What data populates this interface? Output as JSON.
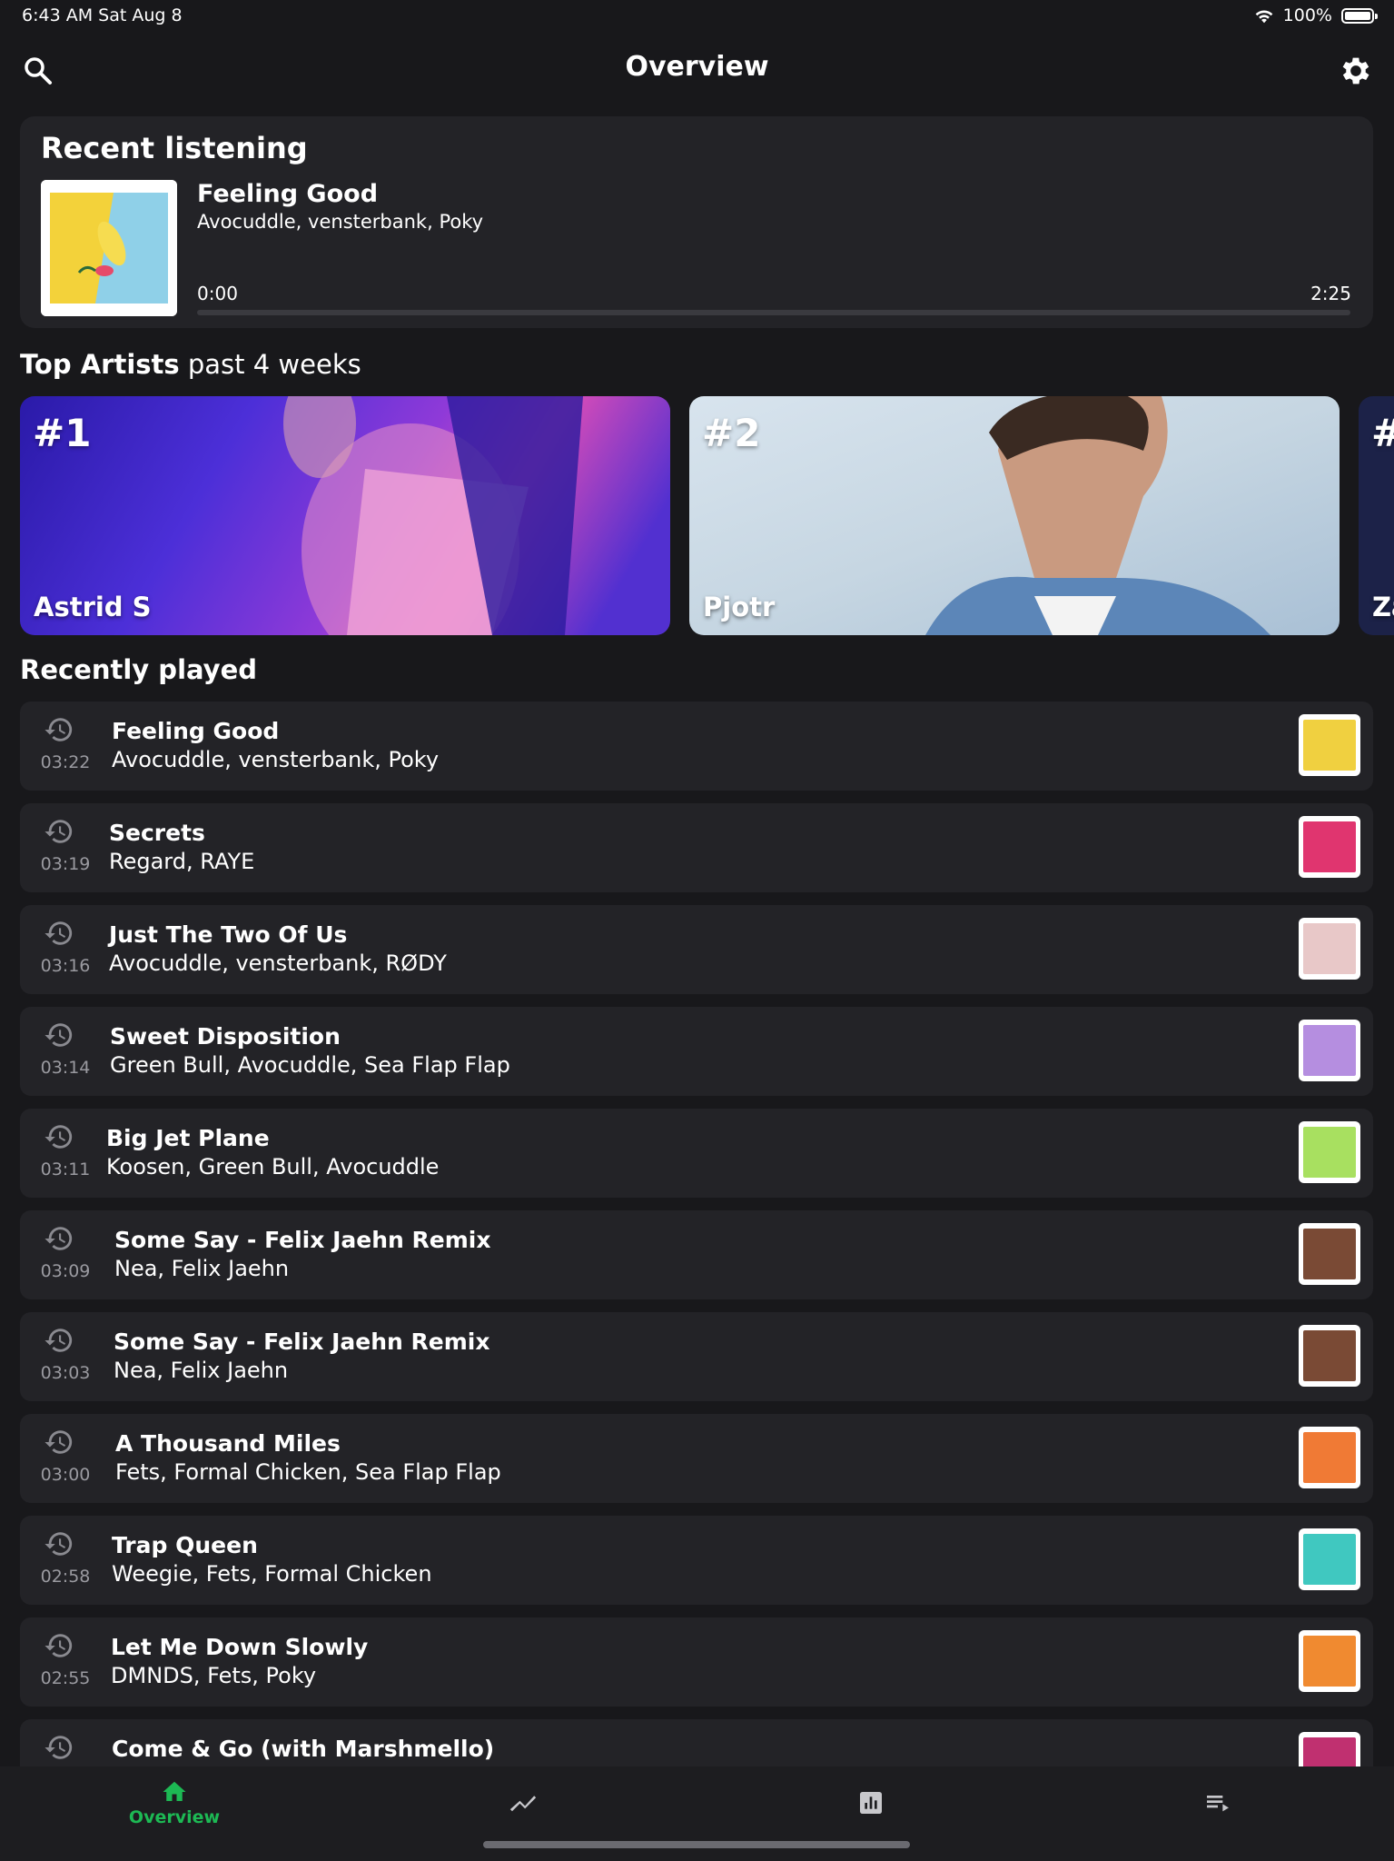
{
  "status_bar": {
    "time": "6:43 AM   Sat Aug 8",
    "battery": "100%",
    "battery_level": 1.0
  },
  "header": {
    "title": "Overview",
    "search_icon": "search-icon",
    "settings_icon": "gear-icon"
  },
  "recent_listening": {
    "title": "Recent listening",
    "song": "Feeling Good",
    "artists": "Avocuddle, vensterbank, Poky",
    "elapsed": "0:00",
    "duration": "2:25",
    "progress": 0.0
  },
  "top_artists": {
    "title_bold": "Top Artists",
    "title_rest": " past 4 weeks",
    "items": [
      {
        "rank": "#1",
        "name": "Astrid S"
      },
      {
        "rank": "#2",
        "name": "Pjotr"
      },
      {
        "rank": "#",
        "name": "Za"
      }
    ]
  },
  "recently_played": {
    "title": "Recently played",
    "items": [
      {
        "time": "03:22",
        "name": "Feeling Good",
        "artists": "Avocuddle, vensterbank, Poky",
        "thumb": "#f0d040"
      },
      {
        "time": "03:19",
        "name": "Secrets",
        "artists": "Regard, RAYE",
        "thumb": "#e0356f"
      },
      {
        "time": "03:16",
        "name": "Just The Two Of Us",
        "artists": "Avocuddle, vensterbank, RØDY",
        "thumb": "#e8c8c8"
      },
      {
        "time": "03:14",
        "name": "Sweet Disposition",
        "artists": "Green Bull, Avocuddle, Sea Flap Flap",
        "thumb": "#b58ee0"
      },
      {
        "time": "03:11",
        "name": "Big Jet Plane",
        "artists": "Koosen, Green Bull, Avocuddle",
        "thumb": "#a8e060"
      },
      {
        "time": "03:09",
        "name": "Some Say - Felix Jaehn Remix",
        "artists": "Nea, Felix Jaehn",
        "thumb": "#7a4a35"
      },
      {
        "time": "03:03",
        "name": "Some Say - Felix Jaehn Remix",
        "artists": "Nea, Felix Jaehn",
        "thumb": "#7a4a35"
      },
      {
        "time": "03:00",
        "name": "A Thousand Miles",
        "artists": "Fets, Formal Chicken, Sea Flap Flap",
        "thumb": "#f07a35"
      },
      {
        "time": "02:58",
        "name": "Trap Queen",
        "artists": "Weegie, Fets, Formal Chicken",
        "thumb": "#40c8c0"
      },
      {
        "time": "02:55",
        "name": "Let Me Down Slowly",
        "artists": "DMNDS, Fets, Poky",
        "thumb": "#f08a30"
      },
      {
        "time": "",
        "name": "Come & Go (with Marshmello)",
        "artists": "",
        "thumb": "#c03070"
      }
    ]
  },
  "bottom_nav": {
    "items": [
      {
        "label": "Overview",
        "icon": "home-icon",
        "active": true
      },
      {
        "label": "",
        "icon": "trending-icon",
        "active": false
      },
      {
        "label": "",
        "icon": "bar-chart-icon",
        "active": false
      },
      {
        "label": "",
        "icon": "playlist-icon",
        "active": false
      }
    ]
  },
  "colors": {
    "accent": "#1db954",
    "background": "#18181b",
    "card": "#232327"
  }
}
